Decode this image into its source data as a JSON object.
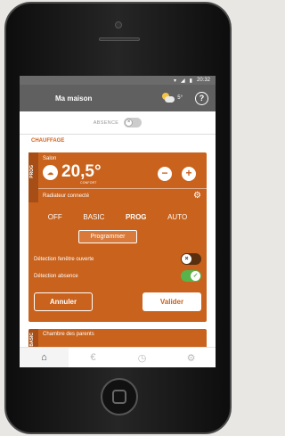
{
  "statusbar": {
    "time": "20:32"
  },
  "appbar": {
    "title": "Ma maison",
    "weather_temp": "5°",
    "help": "?"
  },
  "absence": {
    "label": "ABSENCE"
  },
  "section": {
    "title": "CHAUFFAGE"
  },
  "zone1": {
    "side_label": "PROG",
    "room": "Salon",
    "temperature": "20,5°",
    "temp_status": "CONFORT",
    "minus": "−",
    "plus": "+",
    "device": "Radiateur connecté",
    "modes": [
      {
        "label": "OFF",
        "active": false
      },
      {
        "label": "BASIC",
        "active": false
      },
      {
        "label": "PROG",
        "active": true
      },
      {
        "label": "AUTO",
        "active": false
      }
    ],
    "program_button": "Programmer",
    "window_detection": {
      "label": "Détection fenêtre ouverte",
      "enabled": false
    },
    "absence_detection": {
      "label": "Détection absence",
      "enabled": true
    },
    "cancel": "Annuler",
    "validate": "Valider"
  },
  "zone2": {
    "side_label": "BASIC",
    "room": "Chambre des parents"
  },
  "nav": {
    "tabs": [
      {
        "name": "home-icon",
        "glyph": "⌂",
        "active": true
      },
      {
        "name": "euro-icon",
        "glyph": "€",
        "active": false
      },
      {
        "name": "clock-icon",
        "glyph": "◷",
        "active": false
      },
      {
        "name": "gear-icon",
        "glyph": "⚙",
        "active": false
      }
    ]
  },
  "colors": {
    "accent": "#c8621c",
    "appbar": "#606060",
    "switch_on": "#59b34a"
  }
}
